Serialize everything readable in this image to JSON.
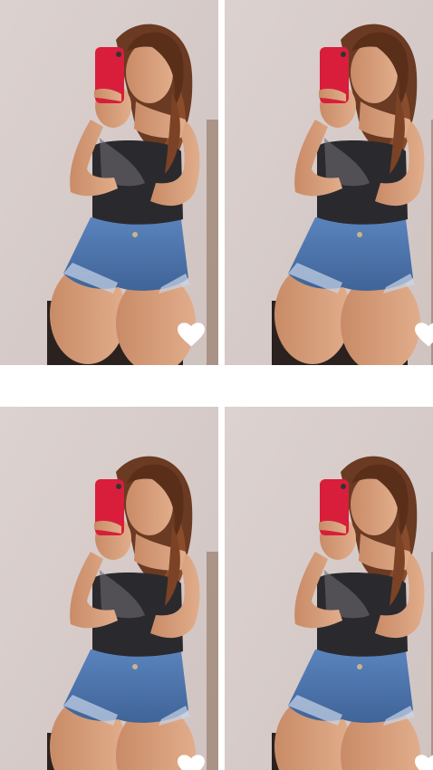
{
  "grid": {
    "tiles": [
      {
        "id": "photo-1",
        "liked": true
      },
      {
        "id": "photo-2",
        "liked": true
      },
      {
        "id": "photo-3",
        "liked": true
      },
      {
        "id": "photo-4",
        "liked": true
      }
    ]
  },
  "colors": {
    "wall": "#d6cbc8",
    "phone_case": "#d81e3a",
    "denim": "#4f77b0",
    "top": "#2a2a2e",
    "skin": "#d7a07e",
    "hair": "#6b3a22",
    "heart": "#ffffff",
    "divider": "#ffffff"
  },
  "icons": {
    "like": "heart-icon"
  }
}
